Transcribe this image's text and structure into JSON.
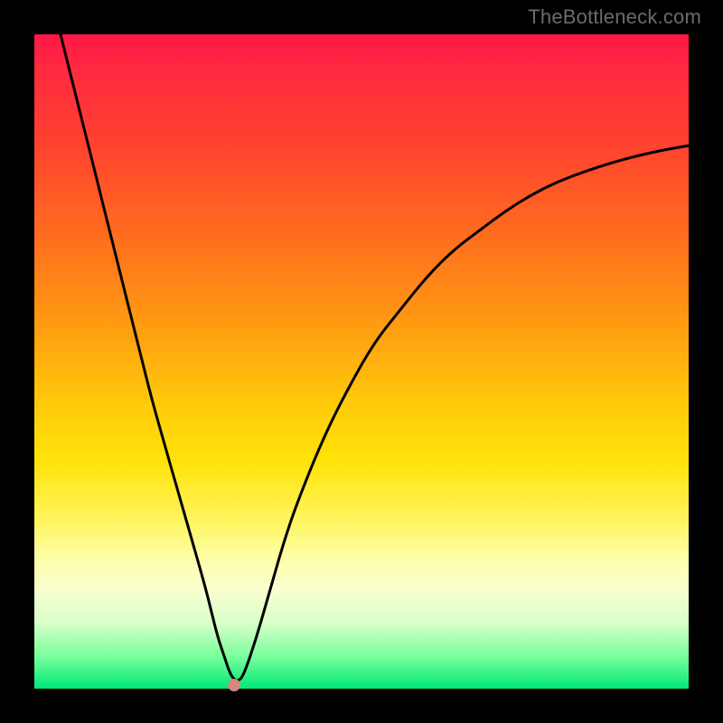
{
  "watermark": "TheBottleneck.com",
  "chart_data": {
    "type": "line",
    "title": "",
    "xlabel": "",
    "ylabel": "",
    "xlim": [
      0,
      100
    ],
    "ylim": [
      0,
      100
    ],
    "grid": false,
    "legend": false,
    "background": "rainbow-vertical",
    "series": [
      {
        "name": "bottleneck-curve",
        "color": "#000000",
        "x": [
          4,
          6,
          8,
          10,
          12,
          14,
          16,
          18,
          20,
          22,
          24,
          26,
          27,
          28,
          29,
          30,
          31,
          32,
          34,
          36,
          38,
          40,
          44,
          48,
          52,
          56,
          60,
          64,
          68,
          72,
          76,
          80,
          84,
          88,
          92,
          96,
          100
        ],
        "y": [
          100,
          92,
          84,
          76,
          68,
          60,
          52,
          44,
          37,
          30,
          23,
          16,
          12,
          8,
          5,
          2,
          1,
          2,
          8,
          15,
          22,
          28,
          38,
          46,
          53,
          58,
          63,
          67,
          70,
          73,
          75.5,
          77.5,
          79,
          80.3,
          81.4,
          82.3,
          83
        ]
      }
    ],
    "marker": {
      "x": 30.5,
      "y": 0.5,
      "color": "#cd8b80"
    }
  }
}
